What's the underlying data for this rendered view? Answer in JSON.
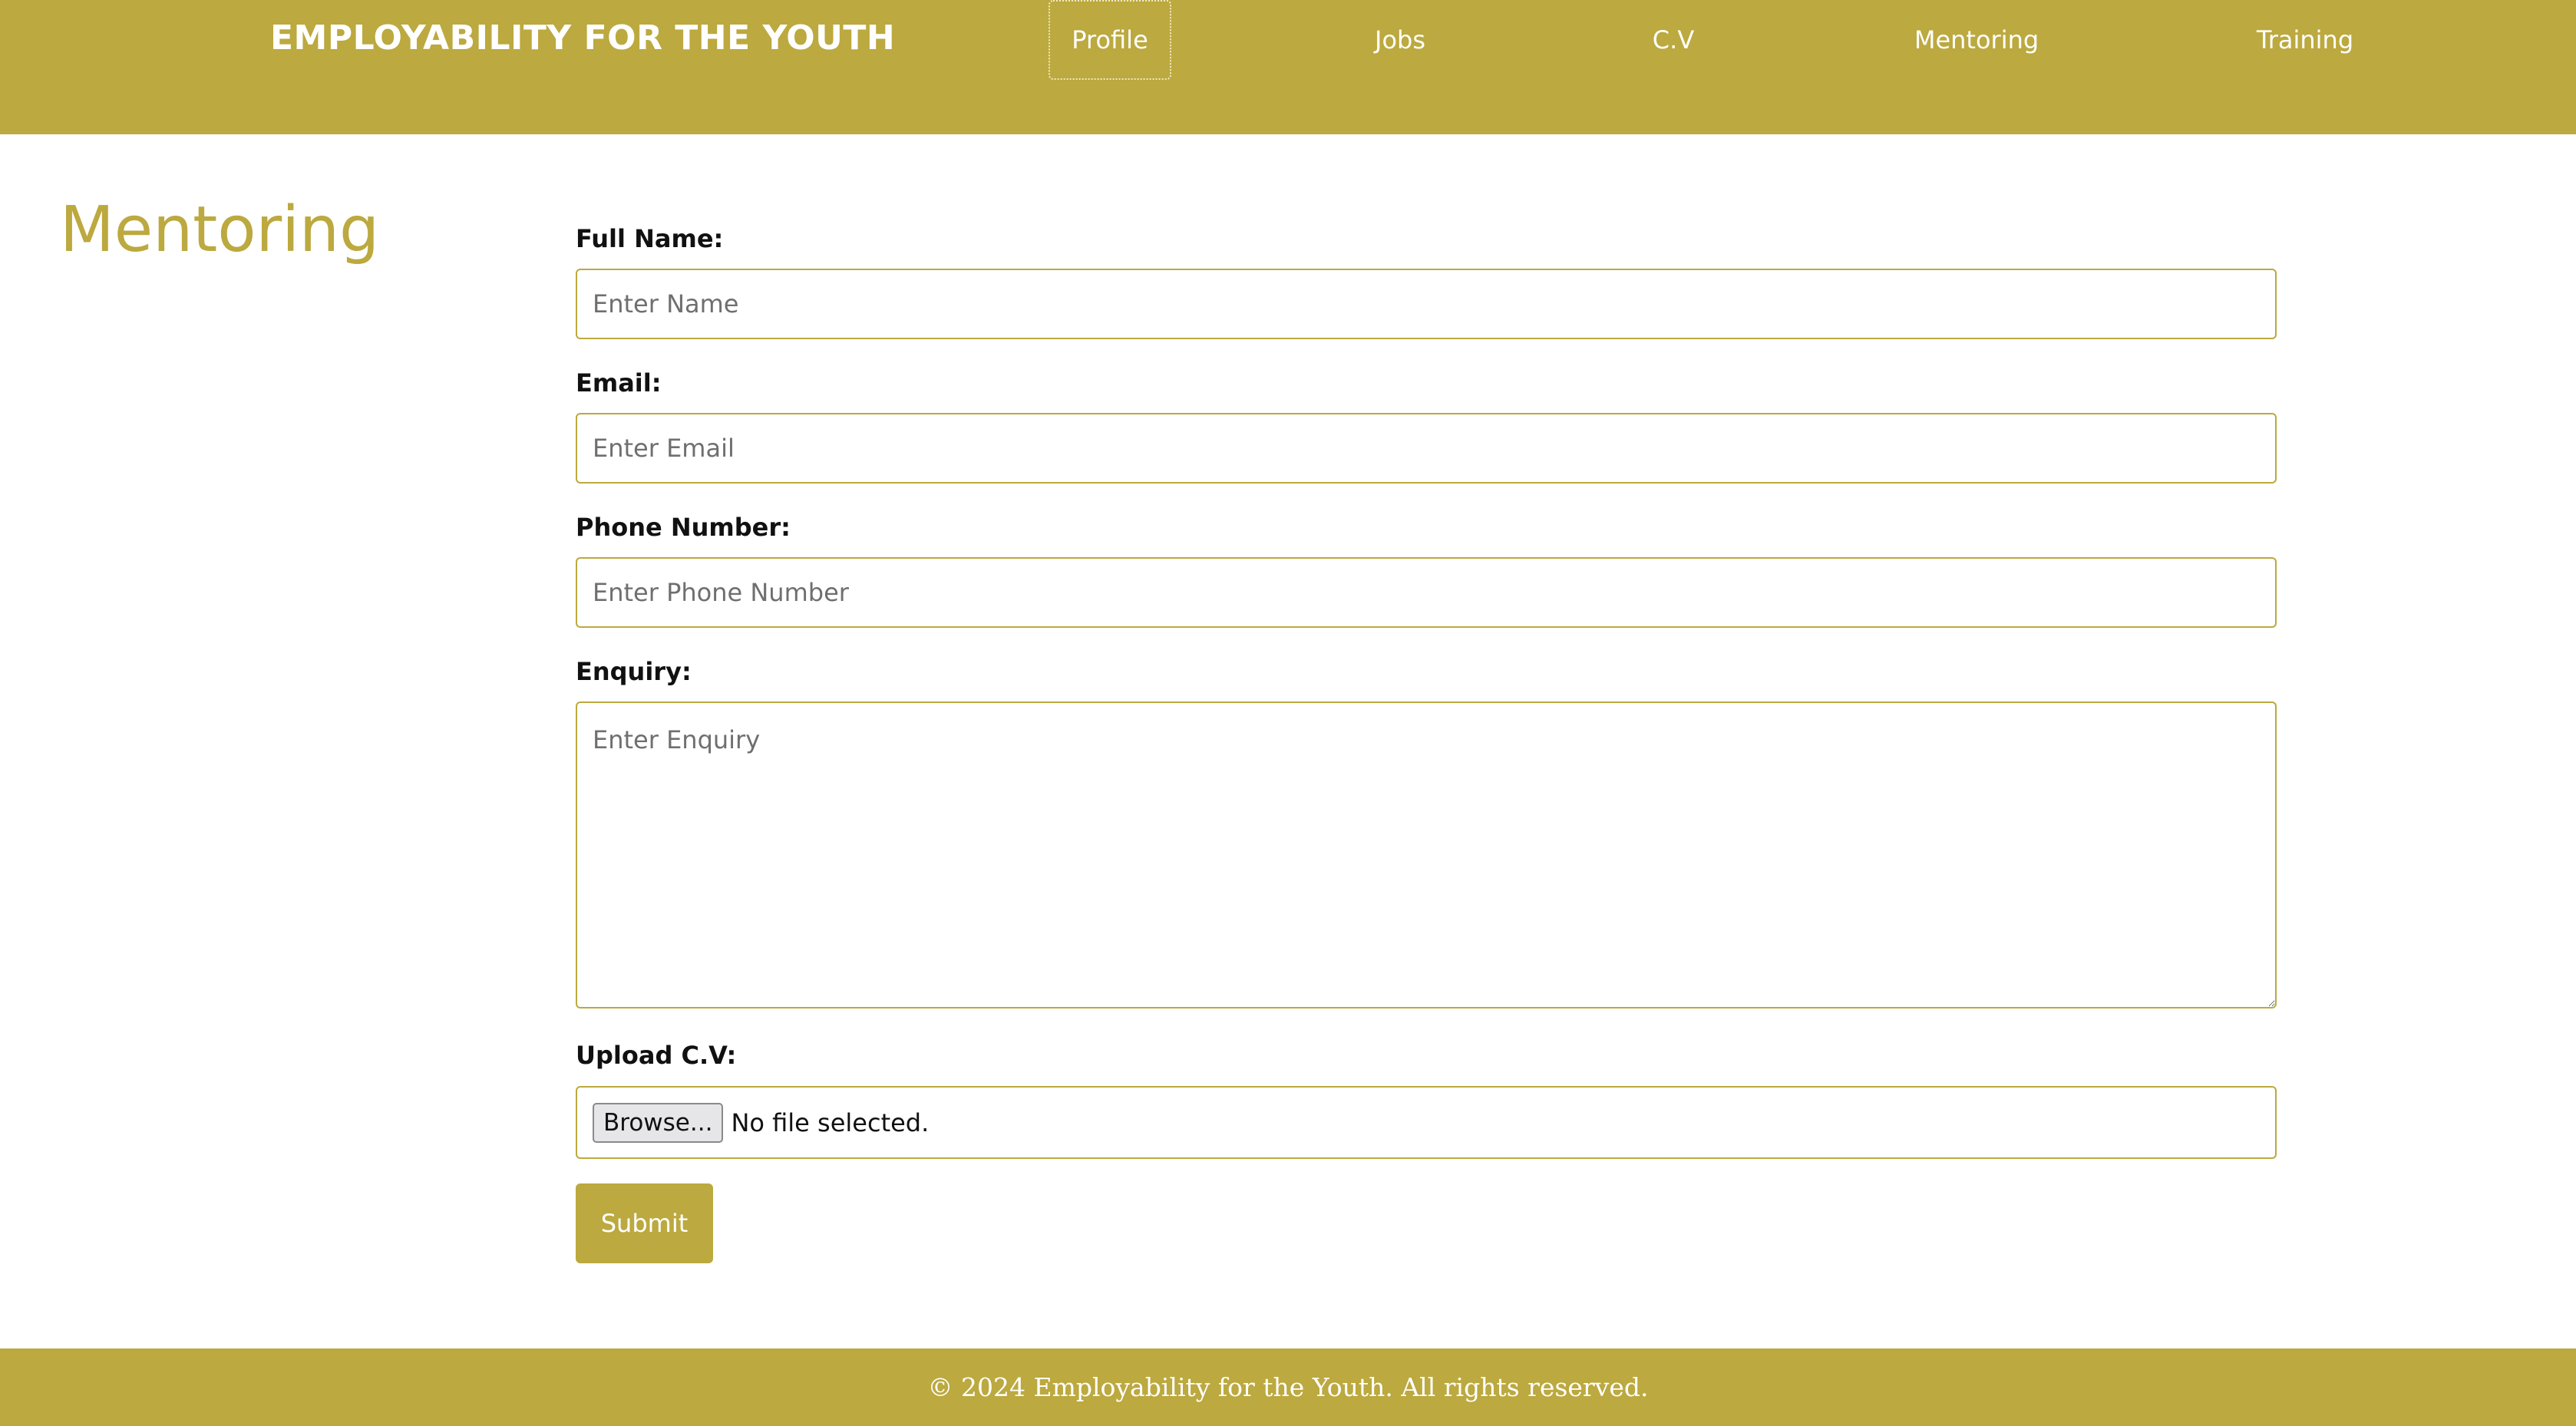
{
  "header": {
    "brand": "EMPLOYABILITY FOR THE YOUTH",
    "nav": [
      {
        "label": "Profile",
        "active": true
      },
      {
        "label": "Jobs",
        "active": false
      },
      {
        "label": "C.V",
        "active": false
      },
      {
        "label": "Mentoring",
        "active": false
      },
      {
        "label": "Training",
        "active": false
      }
    ]
  },
  "page": {
    "title": "Mentoring"
  },
  "form": {
    "full_name": {
      "label": "Full Name:",
      "placeholder": "Enter Name",
      "value": ""
    },
    "email": {
      "label": "Email:",
      "placeholder": "Enter Email",
      "value": ""
    },
    "phone": {
      "label": "Phone Number:",
      "placeholder": "Enter Phone Number",
      "value": ""
    },
    "enquiry": {
      "label": "Enquiry:",
      "placeholder": "Enter Enquiry",
      "value": ""
    },
    "upload": {
      "label": "Upload C.V:",
      "button_label": "Browse...",
      "status": "No file selected."
    },
    "submit_label": "Submit"
  },
  "footer": {
    "text": "© 2024 Employability for the Youth. All rights reserved."
  },
  "colors": {
    "brand": "#bca93f",
    "text_on_brand": "#ffffff",
    "label_text": "#111111",
    "placeholder_text": "#6f6f6f"
  }
}
